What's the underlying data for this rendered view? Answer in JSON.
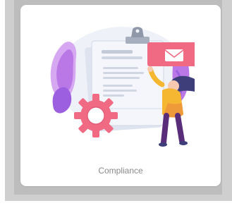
{
  "card": {
    "label": "Compliance",
    "icon": "compliance-illustration-icon"
  },
  "colors": {
    "outer_panel": "#cfcfcf",
    "inner_panel": "#bdbdbd",
    "card_background": "#ffffff",
    "label_text": "#8a8a8a",
    "accent_purple": "#b978e6",
    "accent_pink": "#f06a84",
    "accent_yellow": "#f5b632",
    "document": "#e7ebf3"
  }
}
